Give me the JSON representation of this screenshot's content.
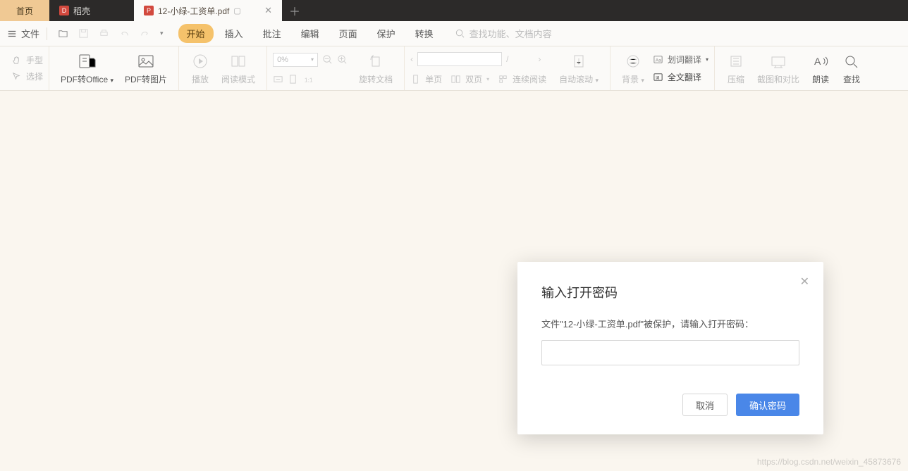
{
  "tabs": {
    "home": "首页",
    "shell": "稻壳",
    "file": "12-小绿-工资单.pdf"
  },
  "menubar": {
    "file": "文件",
    "tabs": [
      "开始",
      "插入",
      "批注",
      "编辑",
      "页面",
      "保护",
      "转换"
    ],
    "active_index": 0,
    "search_placeholder": "查找功能、文档内容"
  },
  "ribbon": {
    "hand": "手型",
    "select": "选择",
    "pdf2office": "PDF转Office",
    "pdf2img": "PDF转图片",
    "play": "播放",
    "readmode": "阅读模式",
    "zoom_value": "0%",
    "rotate": "旋转文档",
    "page_sep": "/",
    "singlepage": "单页",
    "doublepage": "双页",
    "contread": "连续阅读",
    "autoscroll": "自动滚动",
    "background": "背景",
    "wordtrans": "划词翻译",
    "fulltrans": "全文翻译",
    "compress": "压缩",
    "screenshot": "截图和对比",
    "readaloud": "朗读",
    "find": "查找"
  },
  "dialog": {
    "title": "输入打开密码",
    "message": "文件\"12-小绿-工资单.pdf\"被保护，请输入打开密码：",
    "cancel": "取消",
    "confirm": "确认密码"
  },
  "watermark": "https://blog.csdn.net/weixin_45873676"
}
